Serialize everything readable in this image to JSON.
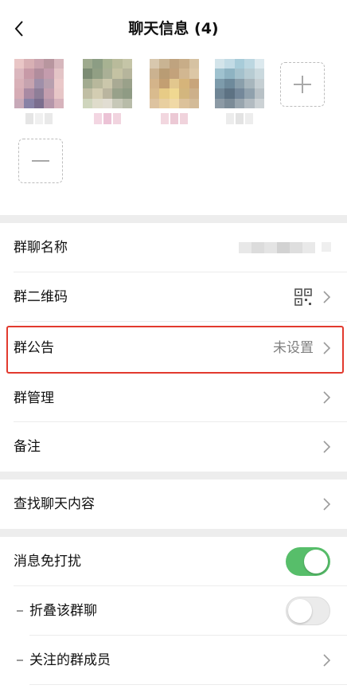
{
  "header": {
    "title": "聊天信息 (4)"
  },
  "members": {
    "count": 4,
    "add_label": "+",
    "remove_label": "—",
    "avatars": [
      [
        "#e9c6c6",
        "#d8b0b4",
        "#c9a2ad",
        "#b8969f",
        "#d7b7bd",
        "#dbb7be",
        "#c79aa7",
        "#b18d9d",
        "#c49cad",
        "#e3c4c6",
        "#d9b1b8",
        "#c6a3af",
        "#9f8fa9",
        "#b79fae",
        "#eac8c9",
        "#d6acb5",
        "#a98aa3",
        "#8e7e98",
        "#c39eae",
        "#e7c6c7",
        "#c7a9b8",
        "#8882a6",
        "#7b6e8e",
        "#b596aa",
        "#d7b3bc"
      ],
      [
        "#9eaa8e",
        "#8c9d84",
        "#a7b292",
        "#b9bb9b",
        "#c5c5a7",
        "#7c8c74",
        "#919f84",
        "#aab096",
        "#c4c2a3",
        "#b6b59c",
        "#a2ab90",
        "#b8b89c",
        "#cbc7ab",
        "#a9aa94",
        "#9aa18a",
        "#c0bea4",
        "#d3cdb2",
        "#bab59f",
        "#98a18a",
        "#8f9b84",
        "#cfd5bd",
        "#dfdccb",
        "#e1ddd2",
        "#c7c8b8",
        "#b8bca9"
      ],
      [
        "#d8c8ae",
        "#c9b493",
        "#bfa37f",
        "#c8ad88",
        "#d6c2a2",
        "#cbb290",
        "#b99c74",
        "#c3a27b",
        "#d2b791",
        "#dcc7a6",
        "#d4b48a",
        "#c39f72",
        "#e2c78e",
        "#d6b47a",
        "#c8a57b",
        "#d9bb8e",
        "#e7cb86",
        "#f0d891",
        "#d3b67e",
        "#cdb08a",
        "#ddc3a0",
        "#e8cfa0",
        "#f0d9a6",
        "#dcc29b",
        "#d3bb98"
      ],
      [
        "#d3e4ea",
        "#c2dbe5",
        "#a8ccd9",
        "#bcd7e1",
        "#dce9ee",
        "#9fc2cf",
        "#8eb3c2",
        "#a4c1cc",
        "#b7ccd3",
        "#cad9de",
        "#7d9bab",
        "#6e8a9b",
        "#8a9fab",
        "#a7b6bd",
        "#c5cfd3",
        "#6f8595",
        "#5d7283",
        "#74889a",
        "#90a1ad",
        "#b8c1c6",
        "#8c9aa5",
        "#7b8b97",
        "#98a5ae",
        "#b2bbc1",
        "#ccd2d5"
      ]
    ],
    "names": [
      [
        "#e5e5e5",
        "#f0f0f0",
        "#e9e9e9"
      ],
      [
        "#f3d6e2",
        "#ecc3d6",
        "#f1d4df"
      ],
      [
        "#f2d7df",
        "#ecc9d5",
        "#f0d3dc"
      ],
      [
        "#ececec",
        "#e3e3e3",
        "#ededed"
      ]
    ]
  },
  "settings": {
    "group_name": {
      "label": "群聊名称"
    },
    "qr_code": {
      "label": "群二维码"
    },
    "announcement": {
      "label": "群公告",
      "value": "未设置"
    },
    "manage": {
      "label": "群管理"
    },
    "remark": {
      "label": "备注"
    },
    "search": {
      "label": "查找聊天内容"
    },
    "mute": {
      "label": "消息免打扰",
      "on": true
    },
    "fold": {
      "label": "折叠该群聊",
      "on": false
    },
    "watch": {
      "label": "关注的群成员"
    }
  },
  "colors": {
    "toggle_on": "#57be6a",
    "highlight_border": "#e23a2e",
    "section_gap": "#ededed"
  }
}
